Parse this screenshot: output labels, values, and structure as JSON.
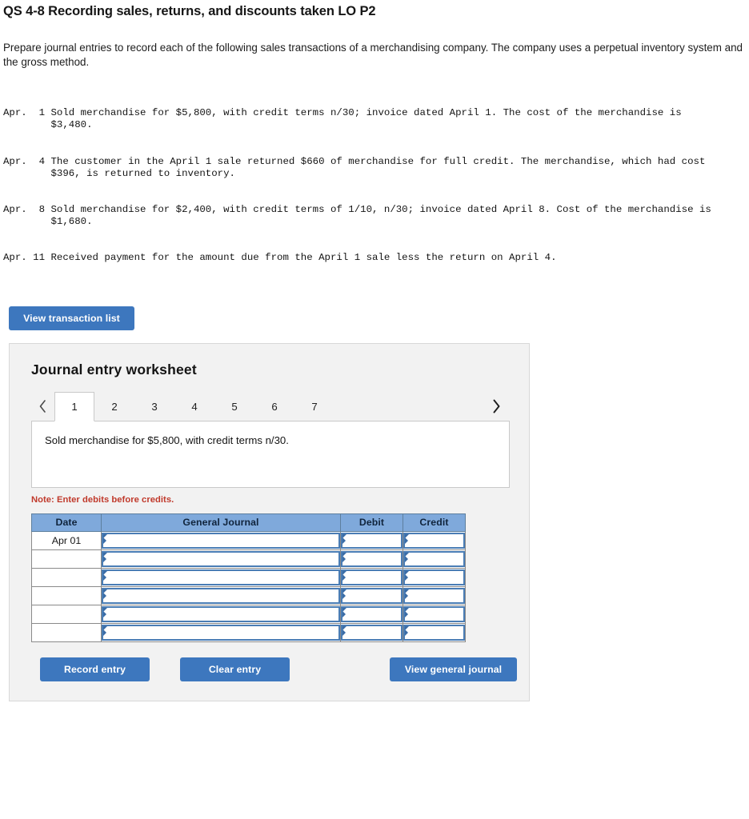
{
  "question": {
    "title": "QS 4-8 Recording sales, returns, and discounts taken LO P2",
    "instructions": "Prepare journal entries to record each of the following sales transactions of a merchandising company. The company uses a perpetual inventory system and the gross method.",
    "transactions": [
      "Apr.  1 Sold merchandise for $5,800, with credit terms n/30; invoice dated April 1. The cost of the merchandise is\n        $3,480.",
      "Apr.  4 The customer in the April 1 sale returned $660 of merchandise for full credit. The merchandise, which had cost\n        $396, is returned to inventory.",
      "Apr.  8 Sold merchandise for $2,400, with credit terms of 1/10, n/30; invoice dated April 8. Cost of the merchandise is\n        $1,680.",
      "Apr. 11 Received payment for the amount due from the April 1 sale less the return on April 4."
    ]
  },
  "view_transaction_button": {
    "label": "View transaction list"
  },
  "worksheet": {
    "title": "Journal entry worksheet",
    "prev_arrow_icon": "chevron-left-icon",
    "next_arrow_icon": "chevron-right-icon",
    "tabs": [
      {
        "label": "1",
        "active": true
      },
      {
        "label": "2",
        "active": false
      },
      {
        "label": "3",
        "active": false
      },
      {
        "label": "4",
        "active": false
      },
      {
        "label": "5",
        "active": false
      },
      {
        "label": "6",
        "active": false
      },
      {
        "label": "7",
        "active": false
      }
    ],
    "prompt": "Sold merchandise for $5,800, with credit terms n/30.",
    "note": "Note: Enter debits before credits.",
    "table": {
      "headers": [
        "Date",
        "General Journal",
        "Debit",
        "Credit"
      ],
      "rows": [
        {
          "date": "Apr 01",
          "general_journal": "",
          "debit": "",
          "credit": ""
        },
        {
          "date": "",
          "general_journal": "",
          "debit": "",
          "credit": ""
        },
        {
          "date": "",
          "general_journal": "",
          "debit": "",
          "credit": ""
        },
        {
          "date": "",
          "general_journal": "",
          "debit": "",
          "credit": ""
        },
        {
          "date": "",
          "general_journal": "",
          "debit": "",
          "credit": ""
        },
        {
          "date": "",
          "general_journal": "",
          "debit": "",
          "credit": ""
        }
      ]
    },
    "actions": {
      "record": "Record entry",
      "clear": "Clear entry",
      "view_general_journal": "View general journal"
    }
  },
  "colors": {
    "button_blue": "#3d77be",
    "table_header_blue": "#7fa9db",
    "input_border_blue": "#4a7db5",
    "note_red": "#c0392b",
    "panel_bg": "#f2f2f2"
  }
}
